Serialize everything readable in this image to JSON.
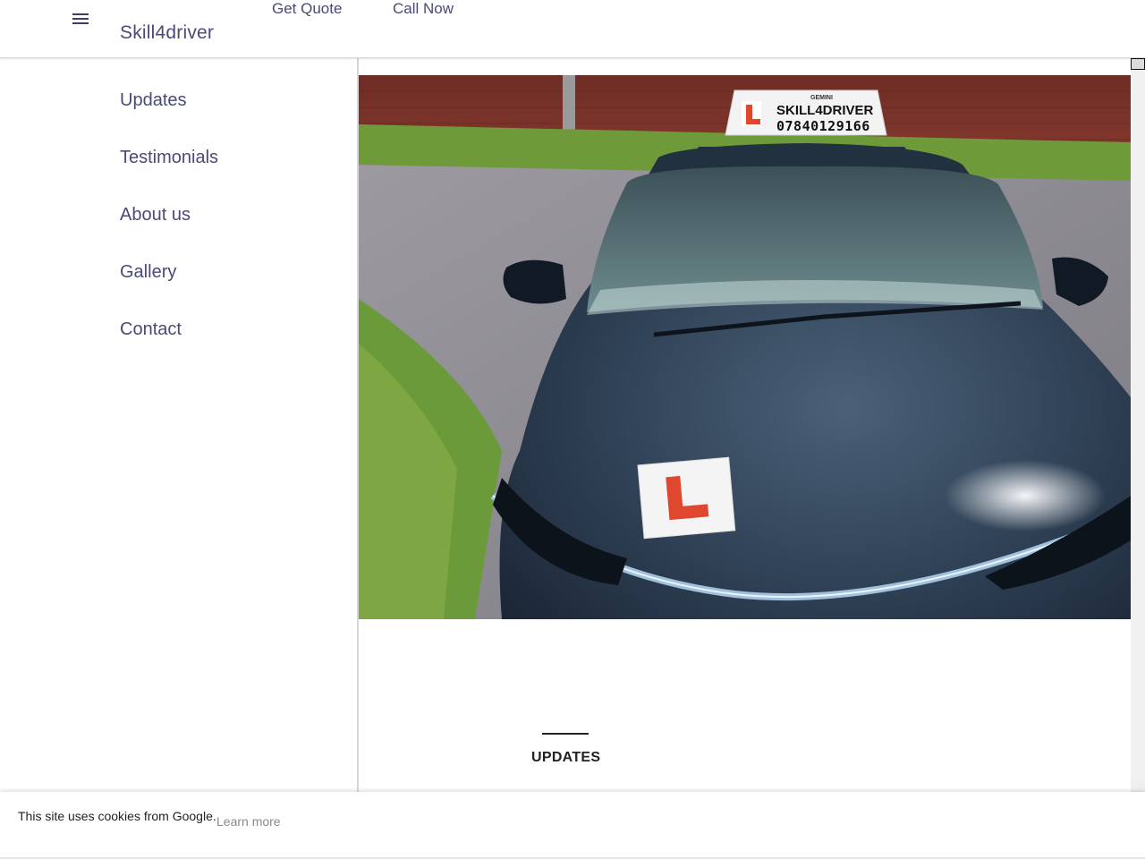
{
  "header": {
    "brand": "Skill4driver",
    "links": {
      "get_quote": "Get Quote",
      "call_now": "Call Now"
    },
    "menu_icon": "hamburger-menu-icon"
  },
  "sidebar": {
    "items": [
      {
        "label": "Updates"
      },
      {
        "label": "Testimonials"
      },
      {
        "label": "About us"
      },
      {
        "label": "Gallery"
      },
      {
        "label": "Contact"
      }
    ]
  },
  "hero": {
    "roof_sign": {
      "brand_small": "GEMINI",
      "name": "SKILL4DRIVER",
      "phone": "07840129166"
    },
    "l_plate_letter": "L"
  },
  "section": {
    "title": "UPDATES"
  },
  "cookie": {
    "text": "This site uses cookies from Google.",
    "link": "Learn more"
  },
  "colors": {
    "accent": "#4a4a78",
    "plate_red": "#e0472f",
    "car_body": "#2b3c4f"
  }
}
